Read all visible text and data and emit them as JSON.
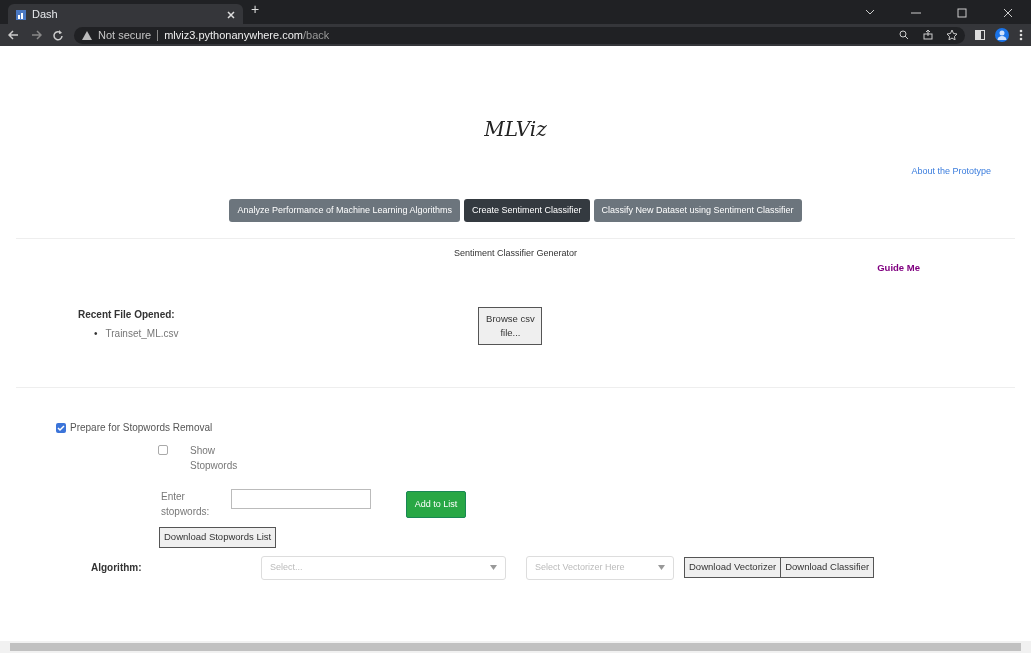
{
  "browser": {
    "tab_title": "Dash",
    "new_tab": "+",
    "address": {
      "security": "Not secure",
      "domain": "mlviz3.pythonanywhere.com",
      "path": "/back"
    }
  },
  "page": {
    "logo": "MLViz",
    "about_link": "About the Prototype",
    "nav_buttons": [
      {
        "label": "Analyze Performance of Machine Learning Algorithms",
        "selected": false
      },
      {
        "label": "Create Sentiment Classifier",
        "selected": true
      },
      {
        "label": "Classify New Dataset using Sentiment Classifier",
        "selected": false
      }
    ],
    "section_title": "Sentiment Classifier Generator",
    "guide_link": "Guide Me",
    "recent_heading": "Recent File Opened:",
    "recent_files": [
      {
        "marker": "•",
        "name": "Trainset_ML.csv"
      }
    ],
    "browse_button": "Browse csv file...",
    "stopwords_checkbox": {
      "label": "Prepare for Stopwords Removal",
      "checked": true
    },
    "show_stopwords": {
      "label": "Show Stopwords",
      "checked": false
    },
    "enter_label": "Enter stopwords:",
    "add_button": "Add to List",
    "download_stopwords": "Download Stopwords List",
    "algorithm_label": "Algorithm:",
    "algorithm_select": {
      "placeholder": "Select..."
    },
    "vectorizer_select": {
      "placeholder": "Select Vectorizer Here"
    },
    "download_vectorizer": "Download Vectorizer",
    "download_classifier": "Download Classifier"
  }
}
